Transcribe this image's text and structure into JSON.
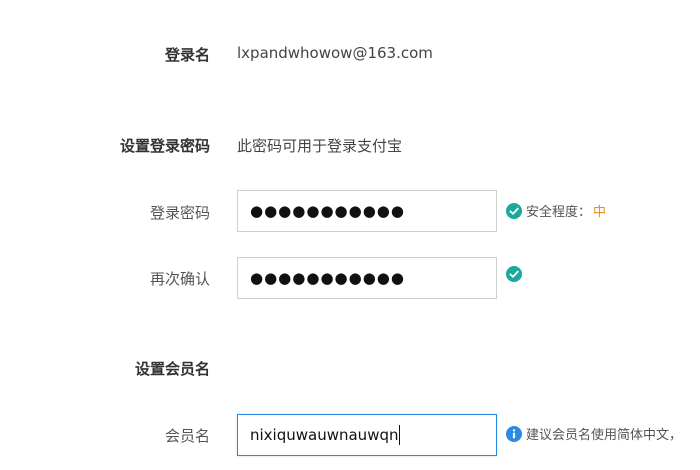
{
  "account": {
    "label": "登录名",
    "value": "lxpandwhowow@163.com"
  },
  "password_section": {
    "title": "设置登录密码",
    "description": "此密码可用于登录支付宝"
  },
  "password": {
    "label": "登录密码",
    "masked_value": "●●●●●●●●●●●",
    "security_label": "安全程度：",
    "security_level": "中"
  },
  "confirm_password": {
    "label": "再次确认",
    "masked_value": "●●●●●●●●●●●"
  },
  "member_section": {
    "title": "设置会员名"
  },
  "member_name": {
    "label": "会员名",
    "value": "nixiquwauwnauwqn",
    "hint": "建议会员名使用简体中文，"
  },
  "colors": {
    "accent_blue": "#2a8be0",
    "success_teal": "#1aa99a",
    "warning_orange": "#f08a1c"
  },
  "icons": {
    "check": "check-circle-icon",
    "info": "info-icon"
  }
}
